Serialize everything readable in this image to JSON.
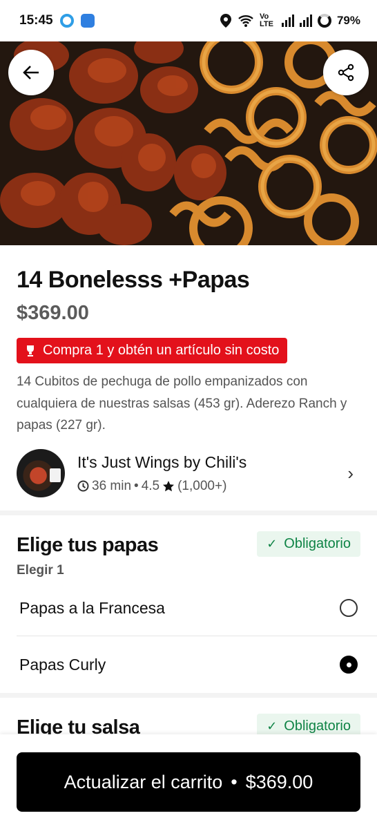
{
  "status_bar": {
    "time": "15:45",
    "network": "Vo LTE",
    "battery": "79%"
  },
  "product": {
    "title": "14 Bonelesss +Papas",
    "price": "$369.00",
    "promo": "Compra 1 y obtén un artículo sin costo",
    "description": "14 Cubitos de pechuga de pollo empanizados con cualquiera de nuestras salsas (453 gr). Aderezo Ranch y papas (227 gr)."
  },
  "restaurant": {
    "name": "It's Just Wings by Chili's",
    "time": "36 min",
    "rating": "4.5",
    "reviews": "(1,000+)"
  },
  "sections": [
    {
      "title": "Elige tus papas",
      "badge": "Obligatorio",
      "subtitle": "Elegir 1",
      "options": [
        {
          "label": "Papas a la Francesa",
          "selected": false
        },
        {
          "label": "Papas Curly",
          "selected": true
        }
      ]
    },
    {
      "title": "Elige tu salsa",
      "badge": "Obligatorio"
    }
  ],
  "cart_button": {
    "label": "Actualizar el carrito",
    "price": "$369.00"
  },
  "colors": {
    "promo": "#e3111b",
    "required_bg": "#eaf6ee",
    "required_text": "#0e8345"
  }
}
